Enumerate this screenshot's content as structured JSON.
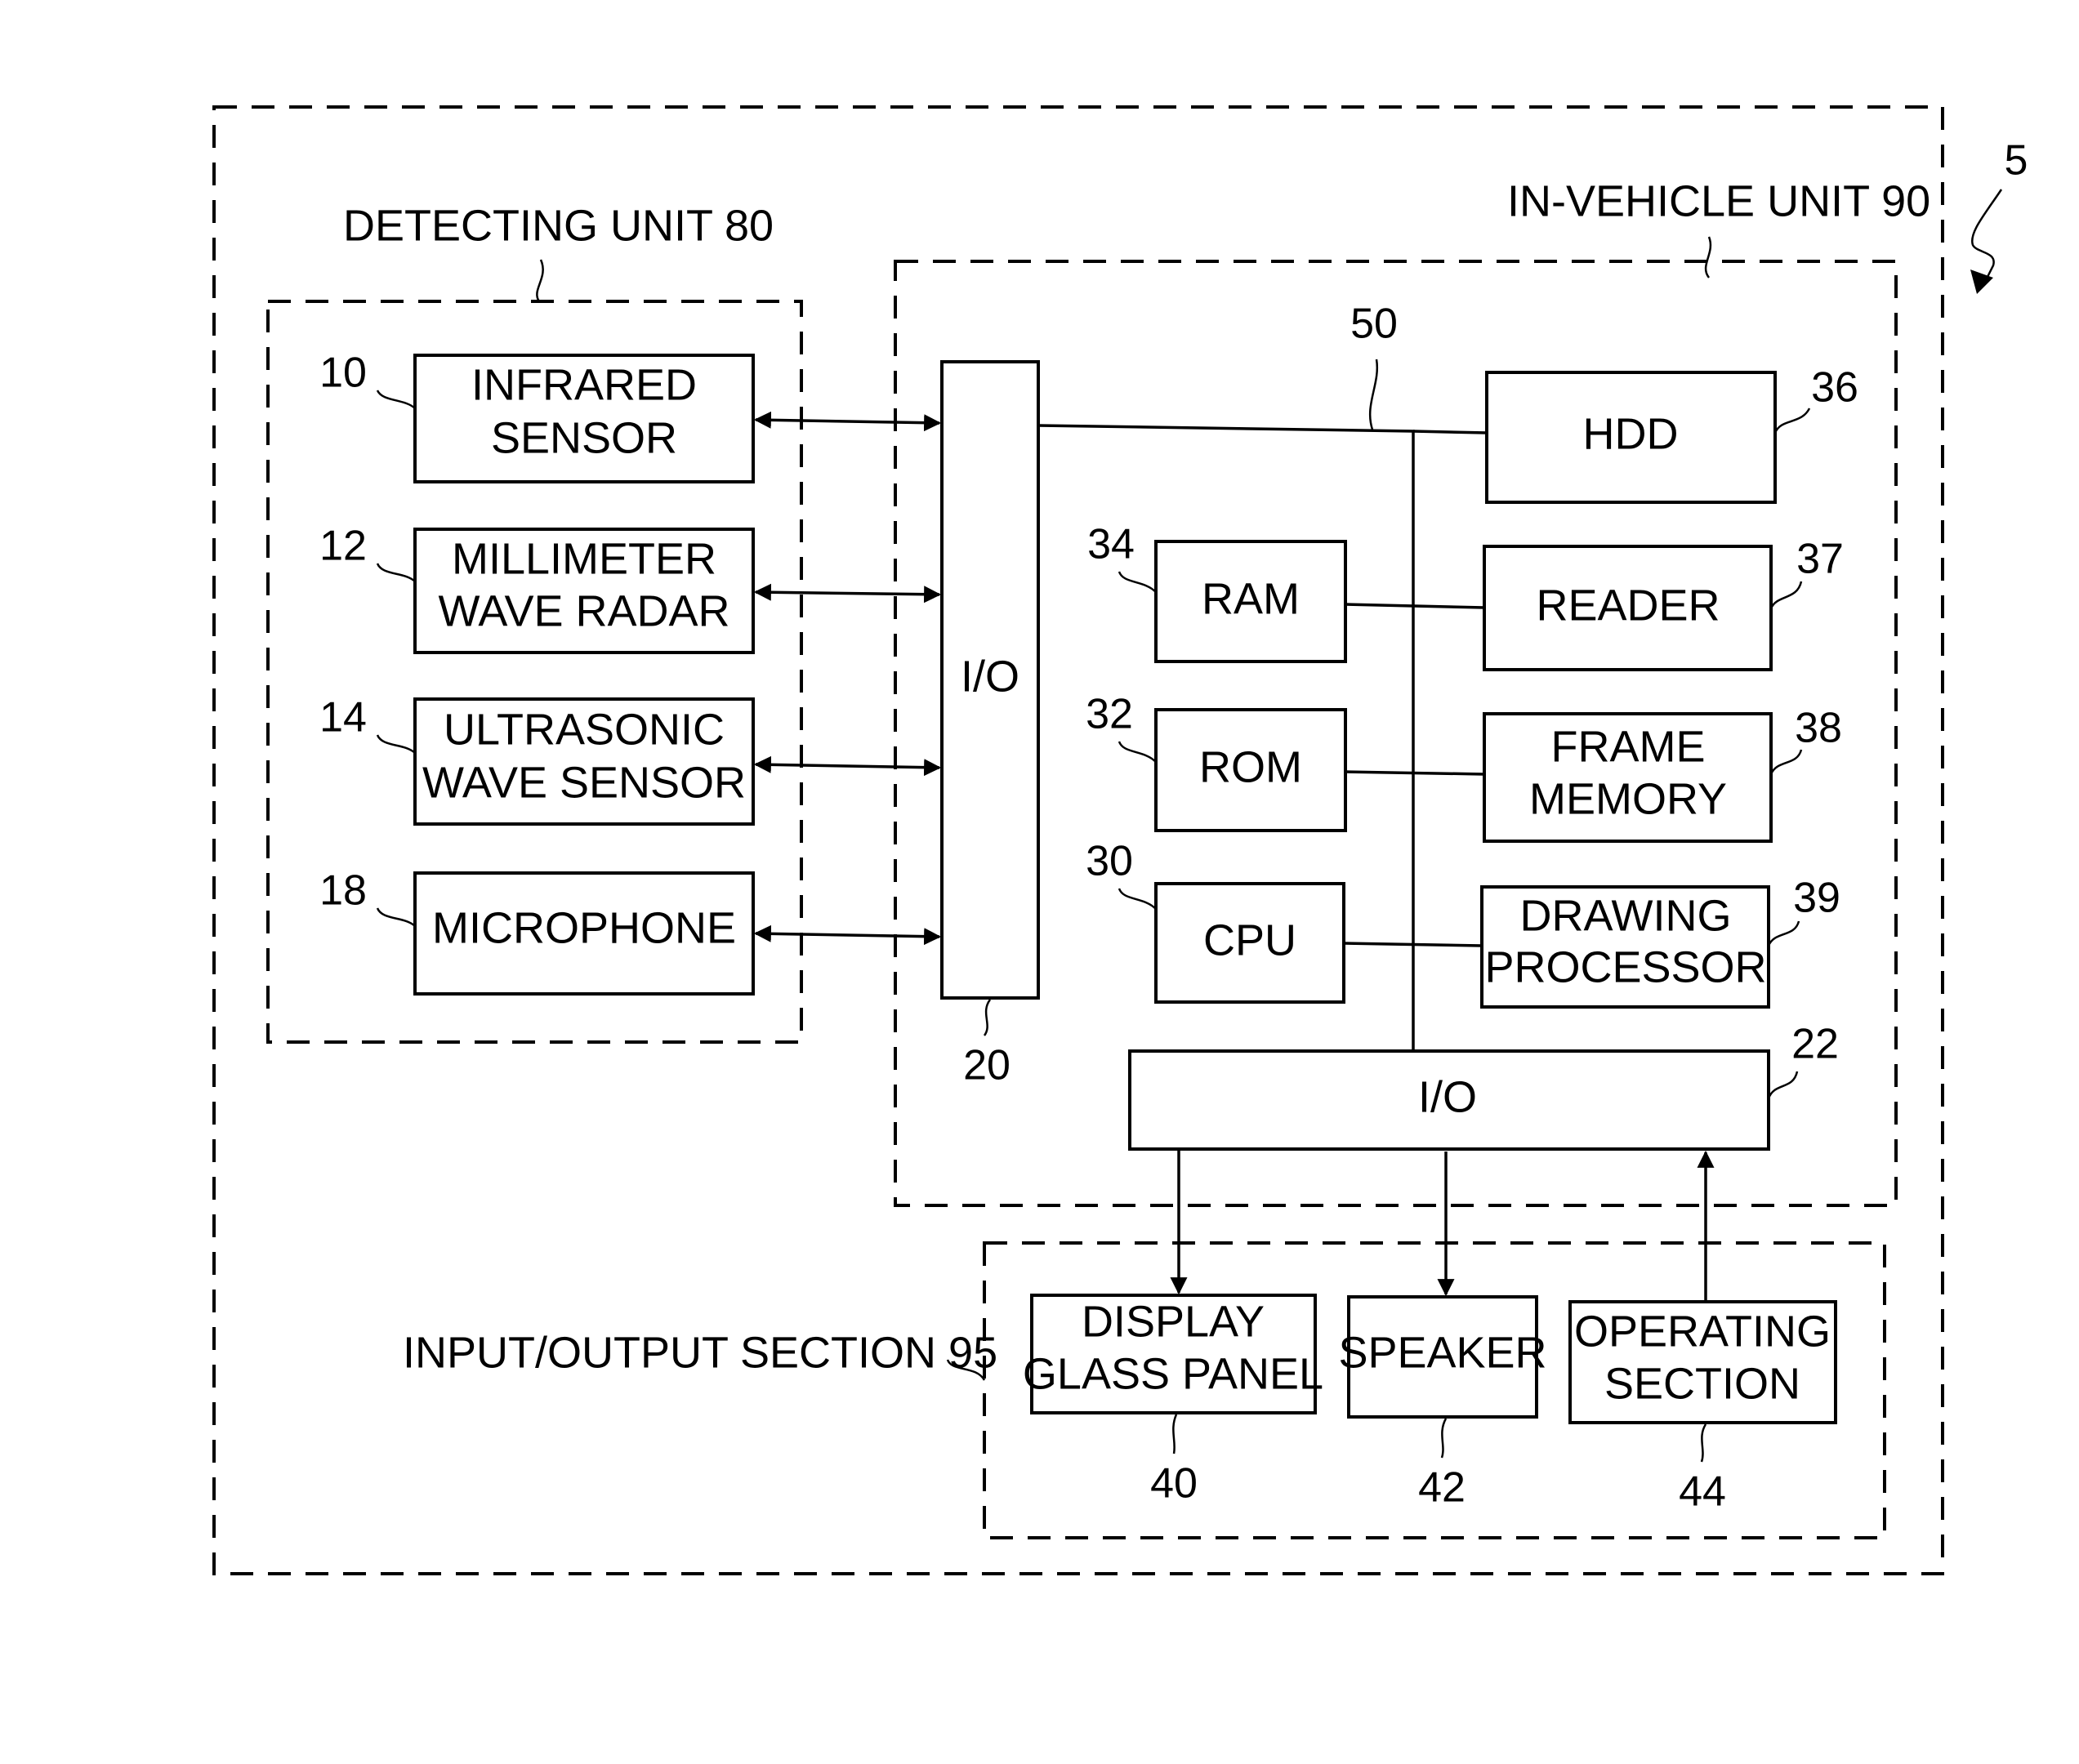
{
  "figure": {
    "ref_label": "5",
    "system_boundary": "vehicle-system"
  },
  "detecting_unit": {
    "title": "DETECTING UNIT 80",
    "sensors": [
      {
        "ref": "10",
        "line1": "INFRARED",
        "line2": "SENSOR"
      },
      {
        "ref": "12",
        "line1": "MILLIMETER",
        "line2": "WAVE RADAR"
      },
      {
        "ref": "14",
        "line1": "ULTRASONIC",
        "line2": "WAVE SENSOR"
      },
      {
        "ref": "18",
        "line1": "MICROPHONE",
        "line2": ""
      }
    ]
  },
  "in_vehicle_unit": {
    "title": "IN-VEHICLE UNIT 90",
    "io_left": {
      "label": "I/O",
      "ref": "20"
    },
    "bus": {
      "ref": "50"
    },
    "left_blocks": [
      {
        "ref": "34",
        "label": "RAM"
      },
      {
        "ref": "32",
        "label": "ROM"
      },
      {
        "ref": "30",
        "label": "CPU"
      }
    ],
    "right_blocks": [
      {
        "ref": "36",
        "line1": "HDD",
        "line2": ""
      },
      {
        "ref": "37",
        "line1": "READER",
        "line2": ""
      },
      {
        "ref": "38",
        "line1": "FRAME",
        "line2": "MEMORY"
      },
      {
        "ref": "39",
        "line1": "DRAWING",
        "line2": "PROCESSOR"
      }
    ],
    "io_bottom": {
      "label": "I/O",
      "ref": "22"
    }
  },
  "io_section": {
    "title": "INPUT/OUTPUT SECTION 95",
    "devices": [
      {
        "ref": "40",
        "line1": "DISPLAY",
        "line2": "GLASS PANEL",
        "direction": "output"
      },
      {
        "ref": "42",
        "line1": "SPEAKER",
        "line2": "",
        "direction": "output"
      },
      {
        "ref": "44",
        "line1": "OPERATING",
        "line2": "SECTION",
        "direction": "input"
      }
    ]
  }
}
